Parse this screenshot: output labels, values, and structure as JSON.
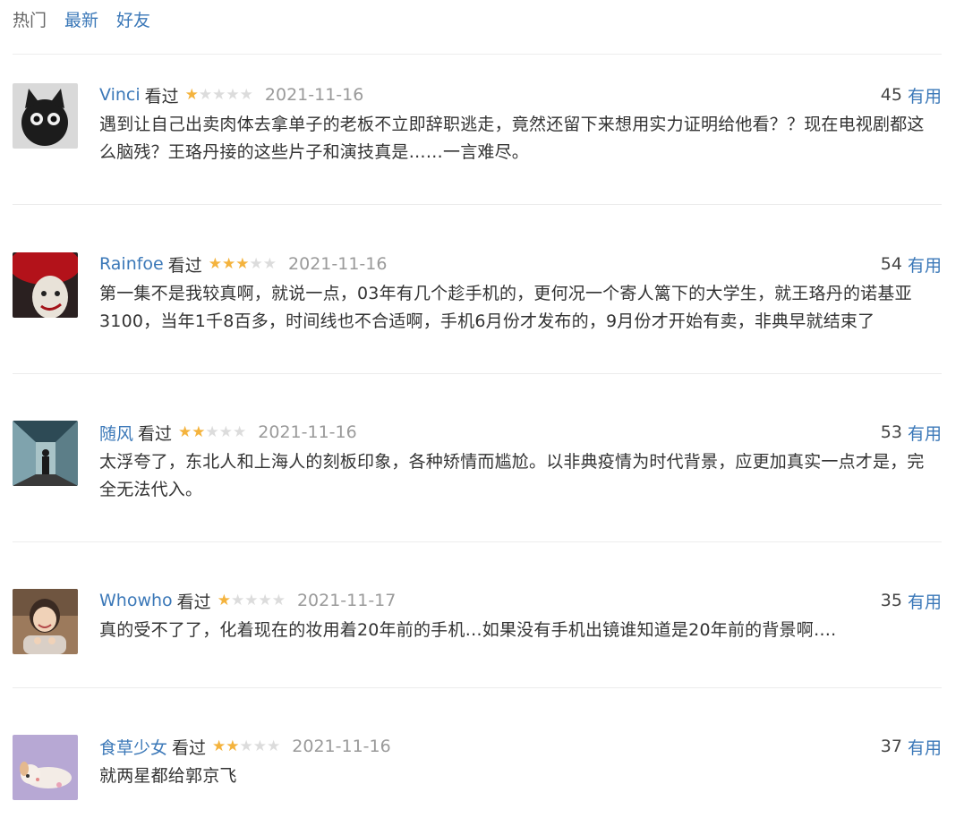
{
  "tabs": [
    {
      "label": "热门"
    },
    {
      "label": "最新"
    },
    {
      "label": "好友"
    }
  ],
  "colors": {
    "link": "#3b78b8",
    "star_on": "#f4b33d",
    "star_off": "#dcdcdc",
    "date": "#9a9a9a"
  },
  "comments": [
    {
      "user": "Vinci",
      "status": "看过",
      "rating": 1,
      "max_rating": 5,
      "date": "2021-11-16",
      "votes": "45",
      "useful_label": "有用",
      "avatar_icon": "black-cat-avatar-icon",
      "text": "遇到让自己出卖肉体去拿单子的老板不立即辞职逃走，竟然还留下来想用实力证明给他看？？现在电视剧都这么脑残？王珞丹接的这些片子和演技真是……一言难尽。"
    },
    {
      "user": "Rainfoe",
      "status": "看过",
      "rating": 3,
      "max_rating": 5,
      "date": "2021-11-16",
      "votes": "54",
      "useful_label": "有用",
      "avatar_icon": "clown-avatar-icon",
      "text": "第一集不是我较真啊，就说一点，03年有几个趁手机的，更何况一个寄人篱下的大学生，就王珞丹的诺基亚3100，当年1千8百多，时间线也不合适啊，手机6月份才发布的，9月份才开始有卖，非典早就结束了"
    },
    {
      "user": "随风",
      "status": "看过",
      "rating": 2,
      "max_rating": 5,
      "date": "2021-11-16",
      "votes": "53",
      "useful_label": "有用",
      "avatar_icon": "corridor-figure-avatar-icon",
      "text": "太浮夸了，东北人和上海人的刻板印象，各种矫情而尴尬。以非典疫情为时代背景，应更加真实一点才是，完全无法代入。"
    },
    {
      "user": "Whowho",
      "status": "看过",
      "rating": 1,
      "max_rating": 5,
      "date": "2021-11-17",
      "votes": "35",
      "useful_label": "有用",
      "avatar_icon": "smiling-person-avatar-icon",
      "text": "真的受不了了，化着现在的妆用着20年前的手机…如果没有手机出镜谁知道是20年前的背景啊…."
    },
    {
      "user": "食草少女",
      "status": "看过",
      "rating": 2,
      "max_rating": 5,
      "date": "2021-11-16",
      "votes": "37",
      "useful_label": "有用",
      "avatar_icon": "sleeping-dog-avatar-icon",
      "text": "就两星都给郭京飞"
    }
  ]
}
